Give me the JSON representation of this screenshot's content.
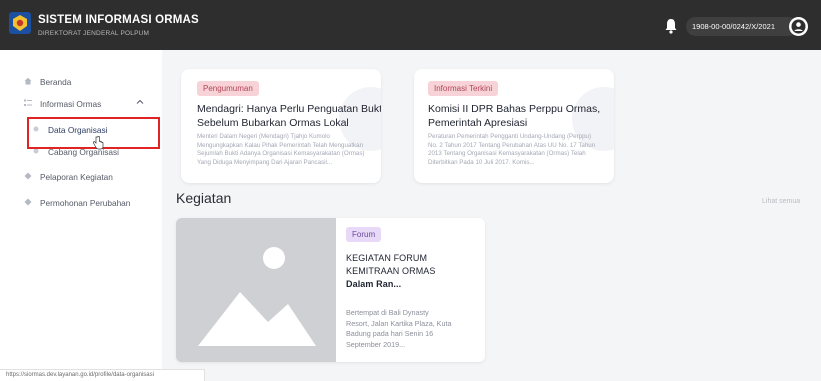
{
  "header": {
    "app_title": "SISTEM INFORMASI ORMAS",
    "app_subtitle": "DIREKTORAT JENDERAL POLPUM",
    "user_id": "1908-00-00/0242/X/2021"
  },
  "sidebar": {
    "items": [
      {
        "label": "Beranda"
      },
      {
        "label": "Informasi Ormas"
      },
      {
        "label": "Data Organisasi"
      },
      {
        "label": "Cabang Organisasi"
      },
      {
        "label": "Pelaporan Kegiatan"
      },
      {
        "label": "Permohonan Perubahan"
      }
    ]
  },
  "news": [
    {
      "badge": "Pengumuman",
      "title_line1": "Mendagri: Hanya Perlu Penguatan Bukti",
      "title_line2": "Sebelum Bubarkan Ormas Lokal",
      "excerpt": [
        "Menteri Dalam Negeri (Mendagri) Tjahjo Kumolo",
        "Mengungkapkan Kalau Pihak Pemerintah Telah Menguatkan",
        "Sejumlah Bukti Adanya Organisasi Kemasyarakatan (Ormas)",
        "Yang Diduga Menyimpang Dari Ajaran Pancasil..."
      ]
    },
    {
      "badge": "Informasi Terkini",
      "title_line1": "Komisi II DPR Bahas Perppu Ormas,",
      "title_line2": "Pemerintah Apresiasi",
      "excerpt": [
        "Peraturan Pemerintah Pengganti Undang-Undang (Perppu)",
        "No. 2 Tahun 2017 Tentang Perubahan Atas UU No. 17 Tahun",
        "2013 Tentang Organisasi Kemasyarakatan (Ormas) Telah",
        "Diterbitkan Pada 10 Juli 2017. Komis..."
      ]
    }
  ],
  "activities": {
    "section_title": "Kegiatan",
    "see_all": "Lihat semua",
    "items": [
      {
        "badge": "Forum",
        "title": [
          "KEGIATAN FORUM",
          "KEMITRAAN ORMAS",
          "Dalam Ran..."
        ],
        "desc": [
          "Bertempat di Bali Dynasty",
          "Resort, Jalan Kartika Plaza, Kuta",
          "Badung pada hari Senin 16",
          "September 2019..."
        ]
      }
    ]
  },
  "statusbar": {
    "url": "https://siormas.dev.layanan.go.id/profile/data-organisasi"
  },
  "colors": {
    "topbar": "#2e2e2e",
    "highlight": "#e02424",
    "badge_red_bg": "#f7d2d6",
    "badge_purple_bg": "#e7d9f7"
  }
}
